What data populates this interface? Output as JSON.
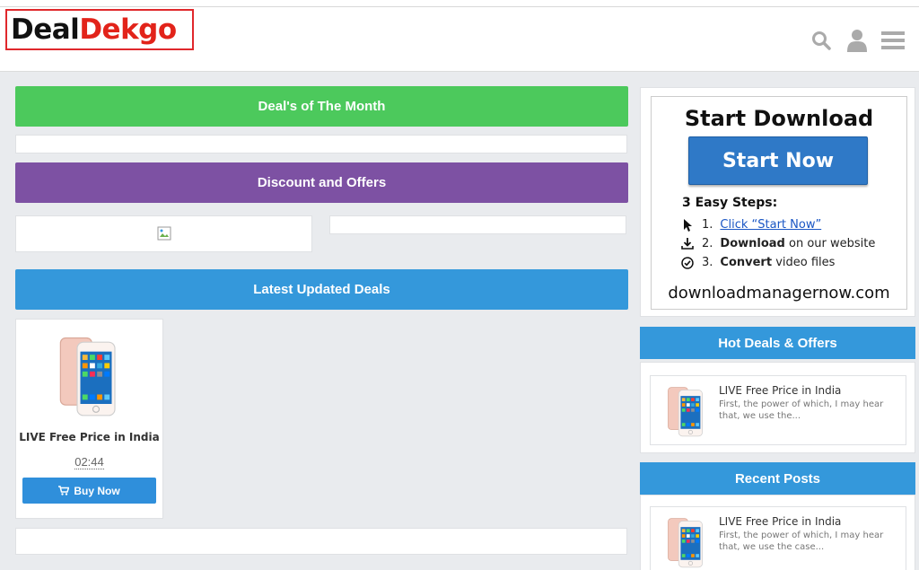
{
  "header": {
    "logo_part1": "Deal",
    "logo_part2": "Dekgo",
    "icons": [
      "search-icon",
      "user-icon",
      "menu-icon"
    ]
  },
  "main": {
    "deals_month_label": "Deal's of The Month",
    "discount_label": "Discount and Offers",
    "latest_label": "Latest Updated Deals",
    "product": {
      "title": "LIVE Free Price in India",
      "time": "02:44",
      "buy_label": "Buy Now"
    }
  },
  "ad": {
    "title": "Start Download",
    "button": "Start Now",
    "steps_heading": "3 Easy Steps:",
    "step1_num": "1.",
    "step1_link": "Click “Start Now”",
    "step2_num": "2.",
    "step2_bold": "Download",
    "step2_rest": "on our website",
    "step3_num": "3.",
    "step3_bold": "Convert",
    "step3_rest": "video files",
    "url": "downloadmanagernow.com"
  },
  "sidebar": {
    "hot_deals_title": "Hot Deals & Offers",
    "hot_post": {
      "title": "LIVE Free Price in India",
      "excerpt": "First, the power of which, I may hear that, we use the..."
    },
    "recent_title": "Recent Posts",
    "recent_post": {
      "title": "LIVE Free Price in India",
      "excerpt": "First, the power of which, I may hear that, we use the case..."
    }
  },
  "colors": {
    "green_bar": "#4cc95c",
    "purple_bar": "#7d51a3",
    "blue_bar": "#3498db",
    "logo_red": "#e2231a"
  }
}
